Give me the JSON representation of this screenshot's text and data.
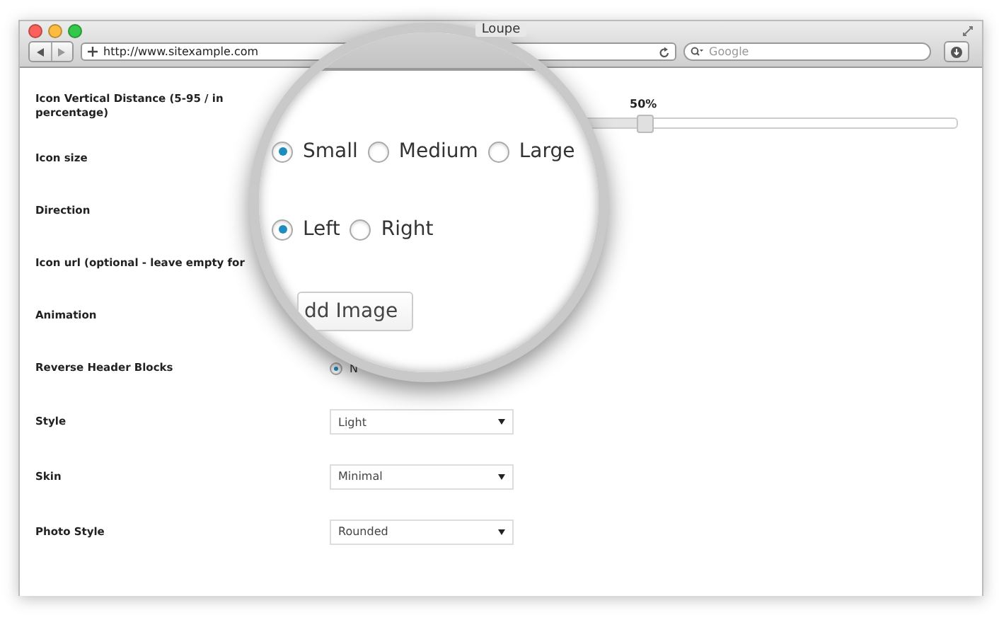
{
  "window": {
    "title": "Loupe"
  },
  "toolbar": {
    "url": "http://www.sitexample.com",
    "search_placeholder": "Google"
  },
  "rows": [
    {
      "label": "Icon Vertical Distance (5-95 / in percentage)",
      "kind": "slider",
      "level": 0.5,
      "reading": "50%"
    },
    {
      "label": "Icon size",
      "kind": "none"
    },
    {
      "label": "Direction",
      "kind": "none"
    },
    {
      "label": "Icon url (optional - leave empty for",
      "kind": "none"
    },
    {
      "label": "Animation",
      "kind": "none"
    },
    {
      "label": "Reverse Header Blocks",
      "kind": "radio",
      "options": [
        {
          "label": "N",
          "selected": true
        }
      ]
    },
    {
      "label": "Style",
      "kind": "select",
      "value": "Light"
    },
    {
      "label": "Skin",
      "kind": "select",
      "value": "Minimal"
    },
    {
      "label": "Photo Style",
      "kind": "select",
      "value": "Rounded"
    }
  ],
  "loupe": [
    {
      "kind": "radio",
      "options": [
        {
          "label": "Small",
          "selected": true
        },
        {
          "label": "Medium",
          "selected": false
        },
        {
          "label": "Large",
          "selected": false
        }
      ]
    },
    {
      "kind": "radio",
      "options": [
        {
          "label": "Left",
          "selected": true
        },
        {
          "label": "Right",
          "selected": false
        }
      ]
    },
    {
      "kind": "button",
      "label": "dd Image"
    }
  ]
}
